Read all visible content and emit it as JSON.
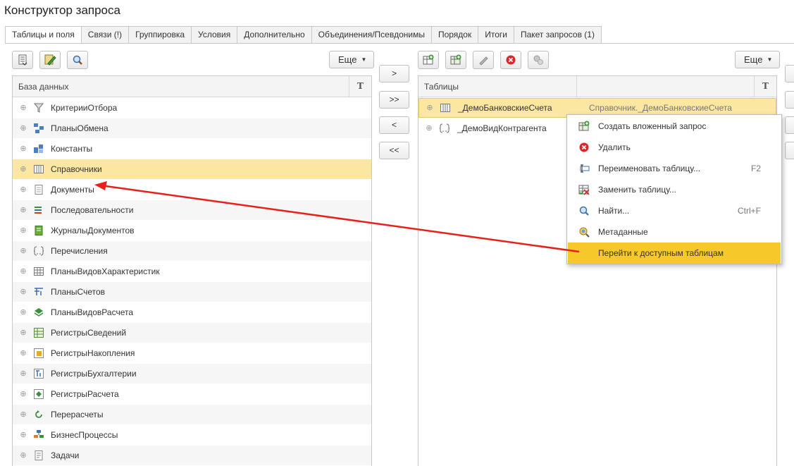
{
  "window": {
    "title": "Конструктор запроса"
  },
  "tabs": [
    {
      "label": "Таблицы и поля",
      "active": true
    },
    {
      "label": "Связи (!)"
    },
    {
      "label": "Группировка"
    },
    {
      "label": "Условия"
    },
    {
      "label": "Дополнительно"
    },
    {
      "label": "Объединения/Псевдонимы"
    },
    {
      "label": "Порядок"
    },
    {
      "label": "Итоги"
    },
    {
      "label": "Пакет запросов (1)"
    }
  ],
  "left_toolbar": {
    "more_label": "Еще"
  },
  "right_toolbar": {
    "more_label": "Еще"
  },
  "database_panel": {
    "header": "База данных",
    "t_col": "T",
    "items": [
      {
        "label": "КритерииОтбора",
        "icon": "filter-criteria-icon"
      },
      {
        "label": "ПланыОбмена",
        "icon": "exchange-plan-icon"
      },
      {
        "label": "Константы",
        "icon": "constants-icon"
      },
      {
        "label": "Справочники",
        "icon": "catalog-icon",
        "selected": true
      },
      {
        "label": "Документы",
        "icon": "document-icon"
      },
      {
        "label": "Последовательности",
        "icon": "sequence-icon"
      },
      {
        "label": "ЖурналыДокументов",
        "icon": "document-journal-icon"
      },
      {
        "label": "Перечисления",
        "icon": "enumeration-icon"
      },
      {
        "label": "ПланыВидовХарактеристик",
        "icon": "characteristic-types-icon"
      },
      {
        "label": "ПланыСчетов",
        "icon": "chart-of-accounts-icon"
      },
      {
        "label": "ПланыВидовРасчета",
        "icon": "calculation-types-icon"
      },
      {
        "label": "РегистрыСведений",
        "icon": "info-register-icon"
      },
      {
        "label": "РегистрыНакопления",
        "icon": "accumulation-register-icon"
      },
      {
        "label": "РегистрыБухгалтерии",
        "icon": "accounting-register-icon"
      },
      {
        "label": "РегистрыРасчета",
        "icon": "calculation-register-icon"
      },
      {
        "label": "Перерасчеты",
        "icon": "recalculation-icon"
      },
      {
        "label": "БизнесПроцессы",
        "icon": "business-process-icon"
      },
      {
        "label": "Задачи",
        "icon": "task-icon"
      }
    ]
  },
  "transfer_buttons": [
    ">",
    ">>",
    "<",
    "<<"
  ],
  "tables_panel": {
    "header": "Таблицы",
    "t_col": "T",
    "rows": [
      {
        "name": "_ДемоБанковскиеСчета",
        "source": "Справочник._ДемоБанковскиеСчета",
        "icon": "catalog-icon",
        "selected": true
      },
      {
        "name": "_ДемоВидКонтрагента",
        "source": "",
        "icon": "enumeration-icon"
      }
    ]
  },
  "context_menu": {
    "items": [
      {
        "label": "Создать вложенный запрос",
        "shortcut": "",
        "icon": "nested-query-icon"
      },
      {
        "label": "Удалить",
        "shortcut": "",
        "icon": "delete-icon"
      },
      {
        "label": "Переименовать таблицу...",
        "shortcut": "F2",
        "icon": "rename-icon"
      },
      {
        "label": "Заменить таблицу...",
        "shortcut": "",
        "icon": "replace-table-icon"
      },
      {
        "label": "Найти...",
        "shortcut": "Ctrl+F",
        "icon": "find-icon"
      },
      {
        "label": "Метаданные",
        "shortcut": "",
        "icon": "metadata-icon"
      },
      {
        "label": "Перейти к доступным таблицам",
        "shortcut": "",
        "icon": "",
        "highlighted": true
      }
    ]
  },
  "colors": {
    "selection": "#fbe7a1",
    "menu_highlight": "#f7c82a",
    "annotation_arrow": "#e8201a"
  }
}
